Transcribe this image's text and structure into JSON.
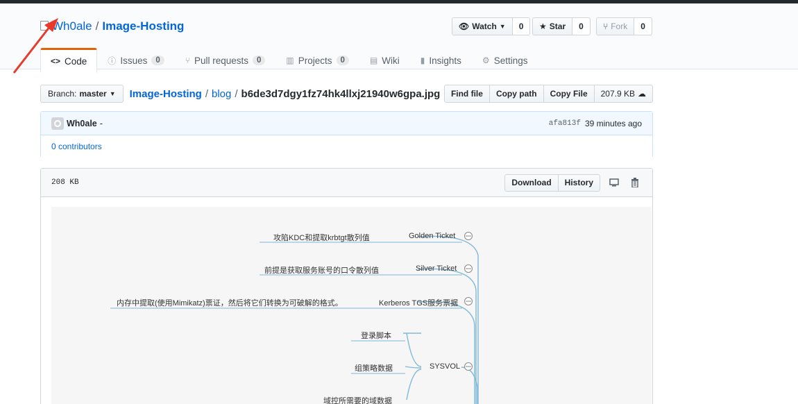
{
  "repo": {
    "owner": "Wh0ale",
    "name": "Image-Hosting"
  },
  "actions": {
    "watch": {
      "label": "Watch",
      "count": "0"
    },
    "star": {
      "label": "Star",
      "count": "0"
    },
    "fork": {
      "label": "Fork",
      "count": "0"
    }
  },
  "tabs": [
    {
      "label": "Code",
      "count": ""
    },
    {
      "label": "Issues",
      "count": "0"
    },
    {
      "label": "Pull requests",
      "count": "0"
    },
    {
      "label": "Projects",
      "count": "0"
    },
    {
      "label": "Wiki",
      "count": ""
    },
    {
      "label": "Insights",
      "count": ""
    },
    {
      "label": "Settings",
      "count": ""
    }
  ],
  "branch": {
    "prefix": "Branch:",
    "name": "master"
  },
  "breadcrumb": {
    "root": "Image-Hosting",
    "dir": "blog",
    "file": "b6de3d7dgy1fz74hk4llxj21940w6gpa.jpg"
  },
  "file_buttons": {
    "find": "Find file",
    "copy_path": "Copy path",
    "copy_file": "Copy File",
    "size": "207.9 KB"
  },
  "commit": {
    "author": "Wh0ale",
    "message": "-",
    "sha": "afa813f",
    "time": "39 minutes ago",
    "contributors": "0 contributors"
  },
  "file_header": {
    "size": "208 KB",
    "download": "Download",
    "history": "History"
  },
  "mindmap": {
    "nodes": [
      {
        "label": "Golden Ticket",
        "desc": "攻陷KDC和提取krbtgt散列值"
      },
      {
        "label": "Silver Ticket",
        "desc": "前提是获取服务账号的口令散列值"
      },
      {
        "label": "Kerberos TGS服务票据",
        "desc": "内存中提取(使用Mimikatz)票证，然后将它们转换为可破解的格式。"
      },
      {
        "label": "SYSVOL",
        "children": [
          "登录脚本",
          "组策略数据",
          "域控所需要的域数据"
        ]
      }
    ]
  },
  "colors": {
    "link": "#0366d6",
    "tab_accent": "#e36209",
    "arrow": "#e8392b"
  }
}
